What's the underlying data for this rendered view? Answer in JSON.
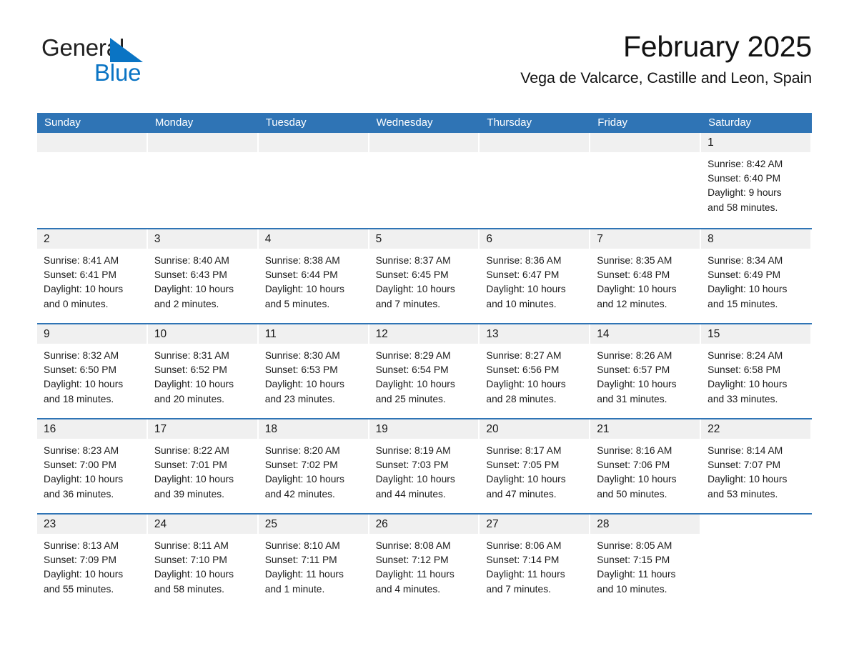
{
  "brand": {
    "word1": "General",
    "word2": "Blue",
    "triangle_color": "#0a74c4",
    "text_color": "#202020"
  },
  "header": {
    "title": "February 2025",
    "subtitle": "Vega de Valcarce, Castille and Leon, Spain"
  },
  "theme": {
    "header_blue": "#2f74b5",
    "day_band_gray": "#f0f0f0",
    "text": "#1a1a1a"
  },
  "weekdays": [
    "Sunday",
    "Monday",
    "Tuesday",
    "Wednesday",
    "Thursday",
    "Friday",
    "Saturday"
  ],
  "weeks": [
    [
      {
        "day": "",
        "lines": [],
        "blank": true
      },
      {
        "day": "",
        "lines": [],
        "blank": true
      },
      {
        "day": "",
        "lines": [],
        "blank": true
      },
      {
        "day": "",
        "lines": [],
        "blank": true
      },
      {
        "day": "",
        "lines": [],
        "blank": true
      },
      {
        "day": "",
        "lines": [],
        "blank": true
      },
      {
        "day": "1",
        "lines": [
          "Sunrise: 8:42 AM",
          "Sunset: 6:40 PM",
          "Daylight: 9 hours",
          "and 58 minutes."
        ],
        "sunrise": "8:42 AM",
        "sunset": "6:40 PM",
        "daylight": "9 hours and 58 minutes."
      }
    ],
    [
      {
        "day": "2",
        "lines": [
          "Sunrise: 8:41 AM",
          "Sunset: 6:41 PM",
          "Daylight: 10 hours",
          "and 0 minutes."
        ],
        "sunrise": "8:41 AM",
        "sunset": "6:41 PM",
        "daylight": "10 hours and 0 minutes."
      },
      {
        "day": "3",
        "lines": [
          "Sunrise: 8:40 AM",
          "Sunset: 6:43 PM",
          "Daylight: 10 hours",
          "and 2 minutes."
        ],
        "sunrise": "8:40 AM",
        "sunset": "6:43 PM",
        "daylight": "10 hours and 2 minutes."
      },
      {
        "day": "4",
        "lines": [
          "Sunrise: 8:38 AM",
          "Sunset: 6:44 PM",
          "Daylight: 10 hours",
          "and 5 minutes."
        ],
        "sunrise": "8:38 AM",
        "sunset": "6:44 PM",
        "daylight": "10 hours and 5 minutes."
      },
      {
        "day": "5",
        "lines": [
          "Sunrise: 8:37 AM",
          "Sunset: 6:45 PM",
          "Daylight: 10 hours",
          "and 7 minutes."
        ],
        "sunrise": "8:37 AM",
        "sunset": "6:45 PM",
        "daylight": "10 hours and 7 minutes."
      },
      {
        "day": "6",
        "lines": [
          "Sunrise: 8:36 AM",
          "Sunset: 6:47 PM",
          "Daylight: 10 hours",
          "and 10 minutes."
        ],
        "sunrise": "8:36 AM",
        "sunset": "6:47 PM",
        "daylight": "10 hours and 10 minutes."
      },
      {
        "day": "7",
        "lines": [
          "Sunrise: 8:35 AM",
          "Sunset: 6:48 PM",
          "Daylight: 10 hours",
          "and 12 minutes."
        ],
        "sunrise": "8:35 AM",
        "sunset": "6:48 PM",
        "daylight": "10 hours and 12 minutes."
      },
      {
        "day": "8",
        "lines": [
          "Sunrise: 8:34 AM",
          "Sunset: 6:49 PM",
          "Daylight: 10 hours",
          "and 15 minutes."
        ],
        "sunrise": "8:34 AM",
        "sunset": "6:49 PM",
        "daylight": "10 hours and 15 minutes."
      }
    ],
    [
      {
        "day": "9",
        "lines": [
          "Sunrise: 8:32 AM",
          "Sunset: 6:50 PM",
          "Daylight: 10 hours",
          "and 18 minutes."
        ],
        "sunrise": "8:32 AM",
        "sunset": "6:50 PM",
        "daylight": "10 hours and 18 minutes."
      },
      {
        "day": "10",
        "lines": [
          "Sunrise: 8:31 AM",
          "Sunset: 6:52 PM",
          "Daylight: 10 hours",
          "and 20 minutes."
        ],
        "sunrise": "8:31 AM",
        "sunset": "6:52 PM",
        "daylight": "10 hours and 20 minutes."
      },
      {
        "day": "11",
        "lines": [
          "Sunrise: 8:30 AM",
          "Sunset: 6:53 PM",
          "Daylight: 10 hours",
          "and 23 minutes."
        ],
        "sunrise": "8:30 AM",
        "sunset": "6:53 PM",
        "daylight": "10 hours and 23 minutes."
      },
      {
        "day": "12",
        "lines": [
          "Sunrise: 8:29 AM",
          "Sunset: 6:54 PM",
          "Daylight: 10 hours",
          "and 25 minutes."
        ],
        "sunrise": "8:29 AM",
        "sunset": "6:54 PM",
        "daylight": "10 hours and 25 minutes."
      },
      {
        "day": "13",
        "lines": [
          "Sunrise: 8:27 AM",
          "Sunset: 6:56 PM",
          "Daylight: 10 hours",
          "and 28 minutes."
        ],
        "sunrise": "8:27 AM",
        "sunset": "6:56 PM",
        "daylight": "10 hours and 28 minutes."
      },
      {
        "day": "14",
        "lines": [
          "Sunrise: 8:26 AM",
          "Sunset: 6:57 PM",
          "Daylight: 10 hours",
          "and 31 minutes."
        ],
        "sunrise": "8:26 AM",
        "sunset": "6:57 PM",
        "daylight": "10 hours and 31 minutes."
      },
      {
        "day": "15",
        "lines": [
          "Sunrise: 8:24 AM",
          "Sunset: 6:58 PM",
          "Daylight: 10 hours",
          "and 33 minutes."
        ],
        "sunrise": "8:24 AM",
        "sunset": "6:58 PM",
        "daylight": "10 hours and 33 minutes."
      }
    ],
    [
      {
        "day": "16",
        "lines": [
          "Sunrise: 8:23 AM",
          "Sunset: 7:00 PM",
          "Daylight: 10 hours",
          "and 36 minutes."
        ],
        "sunrise": "8:23 AM",
        "sunset": "7:00 PM",
        "daylight": "10 hours and 36 minutes."
      },
      {
        "day": "17",
        "lines": [
          "Sunrise: 8:22 AM",
          "Sunset: 7:01 PM",
          "Daylight: 10 hours",
          "and 39 minutes."
        ],
        "sunrise": "8:22 AM",
        "sunset": "7:01 PM",
        "daylight": "10 hours and 39 minutes."
      },
      {
        "day": "18",
        "lines": [
          "Sunrise: 8:20 AM",
          "Sunset: 7:02 PM",
          "Daylight: 10 hours",
          "and 42 minutes."
        ],
        "sunrise": "8:20 AM",
        "sunset": "7:02 PM",
        "daylight": "10 hours and 42 minutes."
      },
      {
        "day": "19",
        "lines": [
          "Sunrise: 8:19 AM",
          "Sunset: 7:03 PM",
          "Daylight: 10 hours",
          "and 44 minutes."
        ],
        "sunrise": "8:19 AM",
        "sunset": "7:03 PM",
        "daylight": "10 hours and 44 minutes."
      },
      {
        "day": "20",
        "lines": [
          "Sunrise: 8:17 AM",
          "Sunset: 7:05 PM",
          "Daylight: 10 hours",
          "and 47 minutes."
        ],
        "sunrise": "8:17 AM",
        "sunset": "7:05 PM",
        "daylight": "10 hours and 47 minutes."
      },
      {
        "day": "21",
        "lines": [
          "Sunrise: 8:16 AM",
          "Sunset: 7:06 PM",
          "Daylight: 10 hours",
          "and 50 minutes."
        ],
        "sunrise": "8:16 AM",
        "sunset": "7:06 PM",
        "daylight": "10 hours and 50 minutes."
      },
      {
        "day": "22",
        "lines": [
          "Sunrise: 8:14 AM",
          "Sunset: 7:07 PM",
          "Daylight: 10 hours",
          "and 53 minutes."
        ],
        "sunrise": "8:14 AM",
        "sunset": "7:07 PM",
        "daylight": "10 hours and 53 minutes."
      }
    ],
    [
      {
        "day": "23",
        "lines": [
          "Sunrise: 8:13 AM",
          "Sunset: 7:09 PM",
          "Daylight: 10 hours",
          "and 55 minutes."
        ],
        "sunrise": "8:13 AM",
        "sunset": "7:09 PM",
        "daylight": "10 hours and 55 minutes."
      },
      {
        "day": "24",
        "lines": [
          "Sunrise: 8:11 AM",
          "Sunset: 7:10 PM",
          "Daylight: 10 hours",
          "and 58 minutes."
        ],
        "sunrise": "8:11 AM",
        "sunset": "7:10 PM",
        "daylight": "10 hours and 58 minutes."
      },
      {
        "day": "25",
        "lines": [
          "Sunrise: 8:10 AM",
          "Sunset: 7:11 PM",
          "Daylight: 11 hours",
          "and 1 minute."
        ],
        "sunrise": "8:10 AM",
        "sunset": "7:11 PM",
        "daylight": "11 hours and 1 minute."
      },
      {
        "day": "26",
        "lines": [
          "Sunrise: 8:08 AM",
          "Sunset: 7:12 PM",
          "Daylight: 11 hours",
          "and 4 minutes."
        ],
        "sunrise": "8:08 AM",
        "sunset": "7:12 PM",
        "daylight": "11 hours and 4 minutes."
      },
      {
        "day": "27",
        "lines": [
          "Sunrise: 8:06 AM",
          "Sunset: 7:14 PM",
          "Daylight: 11 hours",
          "and 7 minutes."
        ],
        "sunrise": "8:06 AM",
        "sunset": "7:14 PM",
        "daylight": "11 hours and 7 minutes."
      },
      {
        "day": "28",
        "lines": [
          "Sunrise: 8:05 AM",
          "Sunset: 7:15 PM",
          "Daylight: 11 hours",
          "and 10 minutes."
        ],
        "sunrise": "8:05 AM",
        "sunset": "7:15 PM",
        "daylight": "11 hours and 10 minutes."
      },
      {
        "day": "",
        "lines": [],
        "blank": true
      }
    ]
  ]
}
